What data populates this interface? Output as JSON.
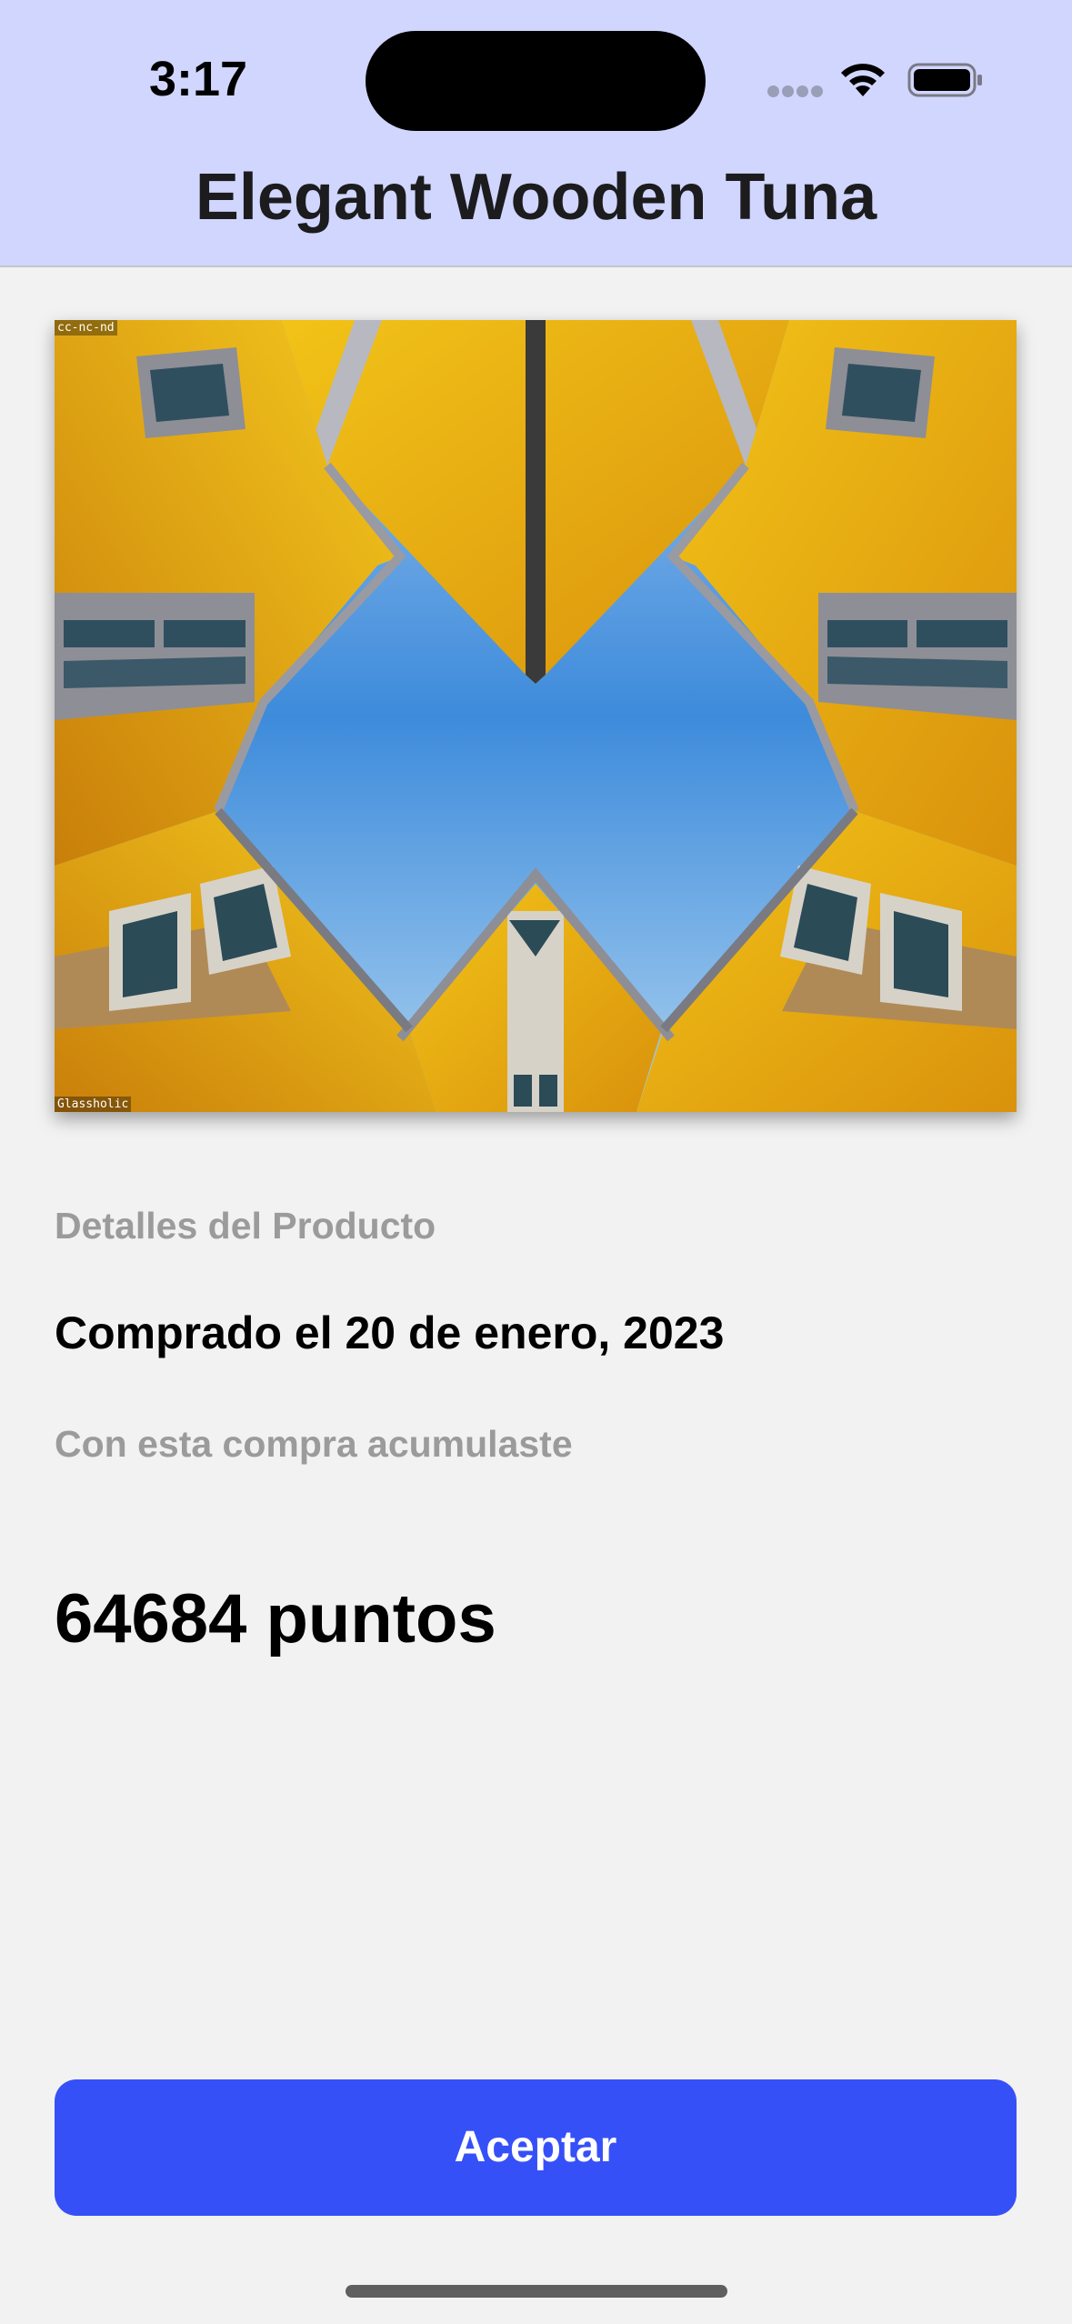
{
  "status_bar": {
    "time": "3:17"
  },
  "header": {
    "title": "Elegant Wooden Tuna"
  },
  "photo": {
    "watermark_top": "cc-nc-nd",
    "watermark_bottom": "Glassholic"
  },
  "details": {
    "section_label": "Detalles del Producto",
    "purchase_date": "Comprado el 20 de enero, 2023",
    "accumulated_label": "Con esta compra acumulaste",
    "points": "64684 puntos"
  },
  "actions": {
    "accept_label": "Aceptar"
  },
  "colors": {
    "header_bg": "#d1d6fe",
    "page_bg": "#f2f2f2",
    "button_bg": "#3650f8",
    "muted_text": "#9b9b9b"
  },
  "icons": {
    "signal": "signal-icon",
    "wifi": "wifi-icon",
    "battery": "battery-icon"
  }
}
